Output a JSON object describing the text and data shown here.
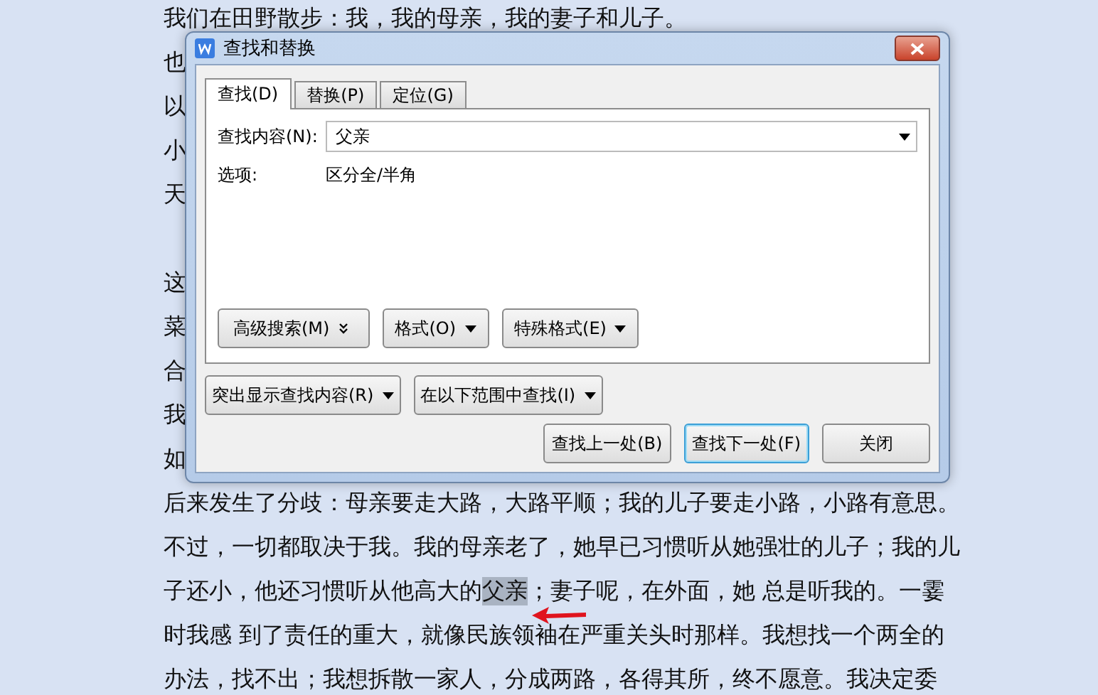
{
  "document": {
    "lines": [
      {
        "kind": "text",
        "text": "我们在田野散步：我，我的母亲，我的妻子和儿子。"
      },
      {
        "kind": "text",
        "text": "也"
      },
      {
        "kind": "text",
        "text": "以"
      },
      {
        "kind": "text",
        "text": "小"
      },
      {
        "kind": "text",
        "text": "天"
      },
      {
        "kind": "blank"
      },
      {
        "kind": "text",
        "text": "这"
      },
      {
        "kind": "text",
        "text": "菜"
      },
      {
        "kind": "text",
        "text": "合"
      },
      {
        "kind": "text",
        "text": "我"
      },
      {
        "kind": "text",
        "text": "如"
      },
      {
        "kind": "text",
        "text": "后来发生了分歧：母亲要走大路，大路平顺；我的儿子要走小路，小路有意思。"
      },
      {
        "kind": "text",
        "text": "不过，一切都取决于我。我的母亲老了，她早已习惯听从她强壮的儿子；我的儿"
      },
      {
        "kind": "highlight",
        "before": "子还小，他还习惯听从他高大的",
        "highlighted": "父亲",
        "after": "；妻子呢，在外面，她 总是听我的。一霎"
      },
      {
        "kind": "text",
        "text": "时我感 到了责任的重大，就像民族领袖在严重关头时那样。我想找一个两全的"
      },
      {
        "kind": "text",
        "text": "办法，找不出；我想拆散一家人，分成两路，各得其所，终不愿意。我决定委"
      }
    ]
  },
  "dialog": {
    "title": "查找和替换",
    "tabs": [
      {
        "label": "查找(D)",
        "selected": true
      },
      {
        "label": "替换(P)",
        "selected": false
      },
      {
        "label": "定位(G)",
        "selected": false
      }
    ],
    "find_label": "查找内容(N):",
    "find_value": "父亲",
    "options_label": "选项:",
    "options_value": "区分全/半角",
    "panel_buttons": [
      {
        "label": "高级搜索(M)",
        "kind": "expand"
      },
      {
        "label": "格式(O)",
        "kind": "dropdown"
      },
      {
        "label": "特殊格式(E)",
        "kind": "dropdown"
      }
    ],
    "menu_buttons": [
      {
        "label": "突出显示查找内容(R)"
      },
      {
        "label": "在以下范围中查找(I)"
      }
    ],
    "action_buttons": [
      {
        "label": "查找上一处(B)",
        "focused": false
      },
      {
        "label": "查找下一处(F)",
        "focused": true
      },
      {
        "label": "关闭",
        "focused": false
      }
    ]
  }
}
